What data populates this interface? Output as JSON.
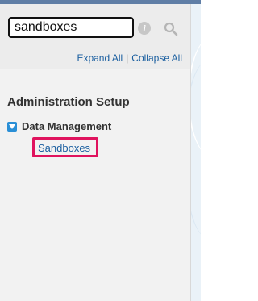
{
  "search": {
    "value": "sandboxes",
    "info_icon": "info-icon",
    "search_icon": "search-icon"
  },
  "tree_controls": {
    "expand_all": "Expand All",
    "separator": "|",
    "collapse_all": "Collapse All"
  },
  "setup": {
    "title": "Administration Setup",
    "node": {
      "label": "Data Management",
      "expanded": true,
      "toggle_icon": "triangle-down-icon",
      "children": [
        {
          "label": "Sandboxes",
          "highlighted": true
        }
      ]
    }
  },
  "colors": {
    "link": "#1b5fa0",
    "highlight": "#e0135e",
    "toggle": "#2a8fd6"
  }
}
